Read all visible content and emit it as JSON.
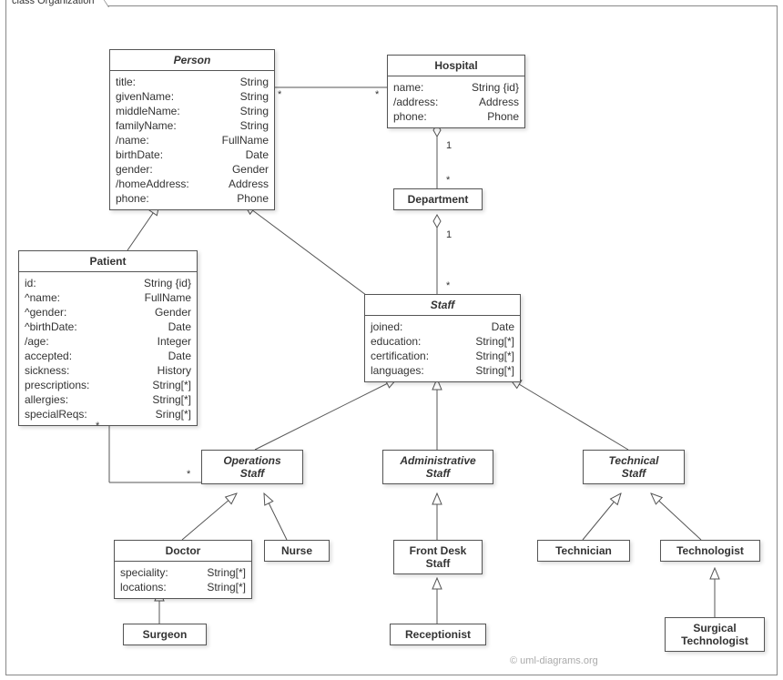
{
  "frame": {
    "label": "class Organization"
  },
  "watermark": "© uml-diagrams.org",
  "classes": {
    "person": {
      "name": "Person",
      "abstract": true,
      "attrs": [
        {
          "n": "title:",
          "t": "String"
        },
        {
          "n": "givenName:",
          "t": "String"
        },
        {
          "n": "middleName:",
          "t": "String"
        },
        {
          "n": "familyName:",
          "t": "String"
        },
        {
          "n": "/name:",
          "t": "FullName"
        },
        {
          "n": "birthDate:",
          "t": "Date"
        },
        {
          "n": "gender:",
          "t": "Gender"
        },
        {
          "n": "/homeAddress:",
          "t": "Address"
        },
        {
          "n": "phone:",
          "t": "Phone"
        }
      ]
    },
    "hospital": {
      "name": "Hospital",
      "abstract": false,
      "attrs": [
        {
          "n": "name:",
          "t": "String {id}"
        },
        {
          "n": "/address:",
          "t": "Address"
        },
        {
          "n": "phone:",
          "t": "Phone"
        }
      ]
    },
    "department": {
      "name": "Department",
      "abstract": false,
      "attrs": []
    },
    "patient": {
      "name": "Patient",
      "abstract": false,
      "attrs": [
        {
          "n": "id:",
          "t": "String {id}"
        },
        {
          "n": "^name:",
          "t": "FullName"
        },
        {
          "n": "^gender:",
          "t": "Gender"
        },
        {
          "n": "^birthDate:",
          "t": "Date"
        },
        {
          "n": "/age:",
          "t": "Integer"
        },
        {
          "n": "accepted:",
          "t": "Date"
        },
        {
          "n": "sickness:",
          "t": "History"
        },
        {
          "n": "prescriptions:",
          "t": "String[*]"
        },
        {
          "n": "allergies:",
          "t": "String[*]"
        },
        {
          "n": "specialReqs:",
          "t": "Sring[*]"
        }
      ]
    },
    "staff": {
      "name": "Staff",
      "abstract": true,
      "attrs": [
        {
          "n": "joined:",
          "t": "Date"
        },
        {
          "n": "education:",
          "t": "String[*]"
        },
        {
          "n": "certification:",
          "t": "String[*]"
        },
        {
          "n": "languages:",
          "t": "String[*]"
        }
      ]
    },
    "opsstaff": {
      "name": "Operations\nStaff",
      "abstract": true,
      "attrs": []
    },
    "adminstaff": {
      "name": "Administrative\nStaff",
      "abstract": true,
      "attrs": []
    },
    "techstaff": {
      "name": "Technical\nStaff",
      "abstract": true,
      "attrs": []
    },
    "doctor": {
      "name": "Doctor",
      "abstract": false,
      "attrs": [
        {
          "n": "speciality:",
          "t": "String[*]"
        },
        {
          "n": "locations:",
          "t": "String[*]"
        }
      ]
    },
    "nurse": {
      "name": "Nurse",
      "abstract": false,
      "attrs": []
    },
    "frontdesk": {
      "name": "Front Desk\nStaff",
      "abstract": false,
      "attrs": []
    },
    "technician": {
      "name": "Technician",
      "abstract": false,
      "attrs": []
    },
    "technologist": {
      "name": "Technologist",
      "abstract": false,
      "attrs": []
    },
    "surgeon": {
      "name": "Surgeon",
      "abstract": false,
      "attrs": []
    },
    "receptionist": {
      "name": "Receptionist",
      "abstract": false,
      "attrs": []
    },
    "surgtech": {
      "name": "Surgical\nTechnologist",
      "abstract": false,
      "attrs": []
    }
  },
  "mults": {
    "person_assoc_left": "*",
    "person_assoc_right": "*",
    "hosp_dept_top": "1",
    "hosp_dept_bottom": "*",
    "dept_staff_top": "1",
    "dept_staff_bottom": "*",
    "patient_ops_left": "*",
    "patient_ops_right": "*"
  }
}
